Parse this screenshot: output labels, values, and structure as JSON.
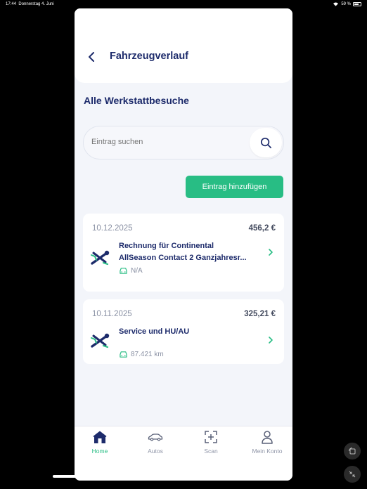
{
  "status": {
    "time": "17:44",
    "date": "Donnerstag 4. Juni",
    "battery": "59 %"
  },
  "header": {
    "title": "Fahrzeugverlauf"
  },
  "section": {
    "title": "Alle Werkstattbesuche"
  },
  "search": {
    "placeholder": "Eintrag suchen"
  },
  "actions": {
    "add_label": "Eintrag hinzufügen"
  },
  "entries": [
    {
      "date": "10.12.2025",
      "amount": "456,2 €",
      "line1": "Rechnung für Continental",
      "line2": "AllSeason Contact 2 Ganzjahresr...",
      "meta": "N/A"
    },
    {
      "date": "10.11.2025",
      "amount": "325,21 €",
      "line1": "Service und HU/AU",
      "meta": "87.421 km"
    }
  ],
  "tabs": [
    {
      "label": "Home",
      "active": true
    },
    {
      "label": "Autos"
    },
    {
      "label": "Scan"
    },
    {
      "label": "Mein Konto"
    }
  ],
  "colors": {
    "accent": "#28bd84",
    "navy": "#1d2b6b",
    "background": "#f3f5fa"
  }
}
